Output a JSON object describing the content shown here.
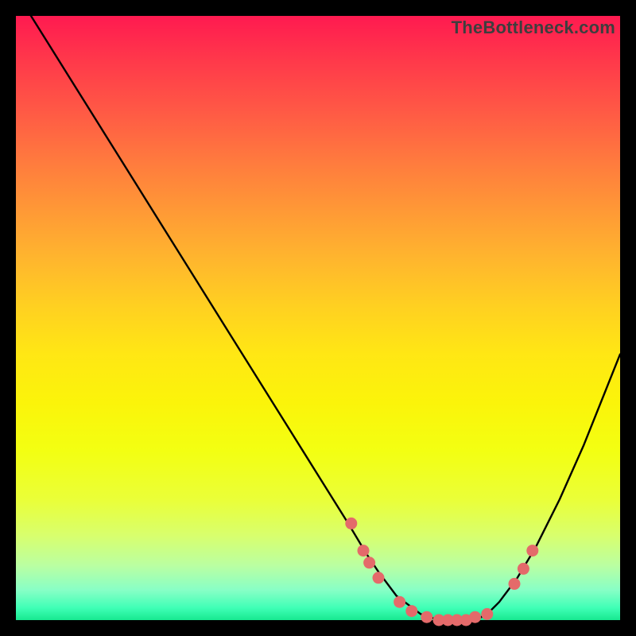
{
  "watermark": "TheBottleneck.com",
  "colors": {
    "background": "#000000",
    "curve_stroke": "#000000",
    "dot_fill": "#e46a6a",
    "gradient_top": "#ff1a50",
    "gradient_bottom": "#17e88f"
  },
  "chart_data": {
    "type": "line",
    "title": "",
    "xlabel": "",
    "ylabel": "",
    "xlim": [
      0,
      100
    ],
    "ylim": [
      0,
      100
    ],
    "grid": false,
    "series": [
      {
        "name": "bottleneck-curve",
        "x": [
          0,
          5,
          10,
          15,
          20,
          25,
          30,
          35,
          40,
          45,
          50,
          55,
          58,
          60,
          63,
          67,
          70,
          73,
          76,
          78,
          80,
          83,
          86,
          90,
          94,
          98,
          100
        ],
        "values": [
          104,
          96,
          88,
          80,
          72,
          64,
          56,
          48,
          40,
          32,
          24,
          16,
          11,
          8,
          4,
          1,
          0,
          0,
          0,
          1,
          3,
          7,
          12,
          20,
          29,
          39,
          44
        ]
      }
    ],
    "dots": [
      {
        "x": 55.5,
        "y": 16.0
      },
      {
        "x": 57.5,
        "y": 11.5
      },
      {
        "x": 58.5,
        "y": 9.5
      },
      {
        "x": 60.0,
        "y": 7.0
      },
      {
        "x": 63.5,
        "y": 3.0
      },
      {
        "x": 65.5,
        "y": 1.5
      },
      {
        "x": 68.0,
        "y": 0.5
      },
      {
        "x": 70.0,
        "y": 0.0
      },
      {
        "x": 71.5,
        "y": 0.0
      },
      {
        "x": 73.0,
        "y": 0.0
      },
      {
        "x": 74.5,
        "y": 0.0
      },
      {
        "x": 76.0,
        "y": 0.5
      },
      {
        "x": 78.0,
        "y": 1.0
      },
      {
        "x": 82.5,
        "y": 6.0
      },
      {
        "x": 84.0,
        "y": 8.5
      },
      {
        "x": 85.5,
        "y": 11.5
      }
    ],
    "annotations": []
  }
}
